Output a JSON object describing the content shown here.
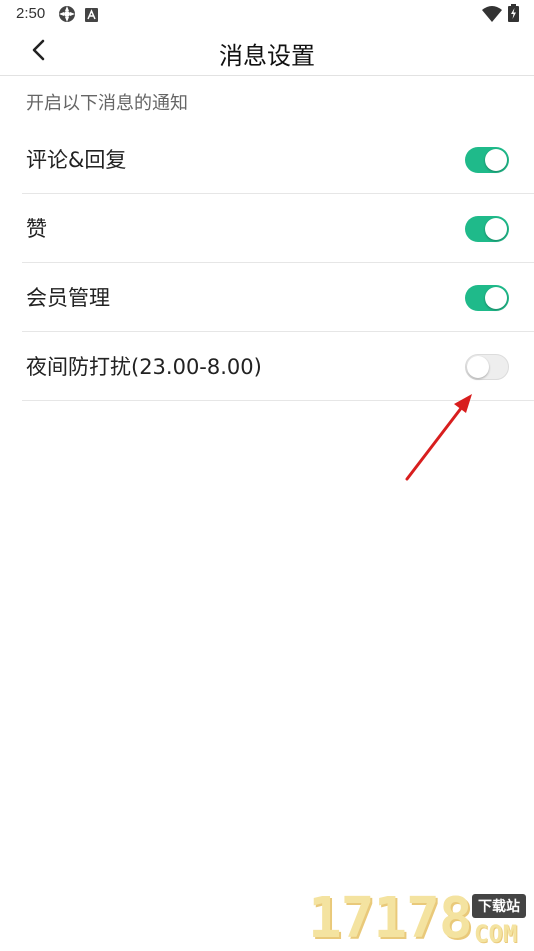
{
  "status_bar": {
    "time": "2:50",
    "left_icons": [
      "settings-app-icon",
      "font-app-icon"
    ],
    "right_icons": [
      "wifi-icon",
      "battery-icon"
    ]
  },
  "header": {
    "back_icon": "chevron-left-icon",
    "title": "消息设置"
  },
  "section": {
    "hint": "开启以下消息的通知"
  },
  "settings": [
    {
      "label": "评论&回复",
      "enabled": true
    },
    {
      "label": "赞",
      "enabled": true
    },
    {
      "label": "会员管理",
      "enabled": true
    },
    {
      "label": "夜间防打扰(23.00-8.00)",
      "enabled": false
    }
  ],
  "colors": {
    "toggle_on": "#1fba8a",
    "toggle_off": "#eeeeee",
    "annotation_arrow": "#d81e1e"
  },
  "watermark": {
    "number": "17178",
    "badge": "下载站",
    "suffix": "COM"
  }
}
